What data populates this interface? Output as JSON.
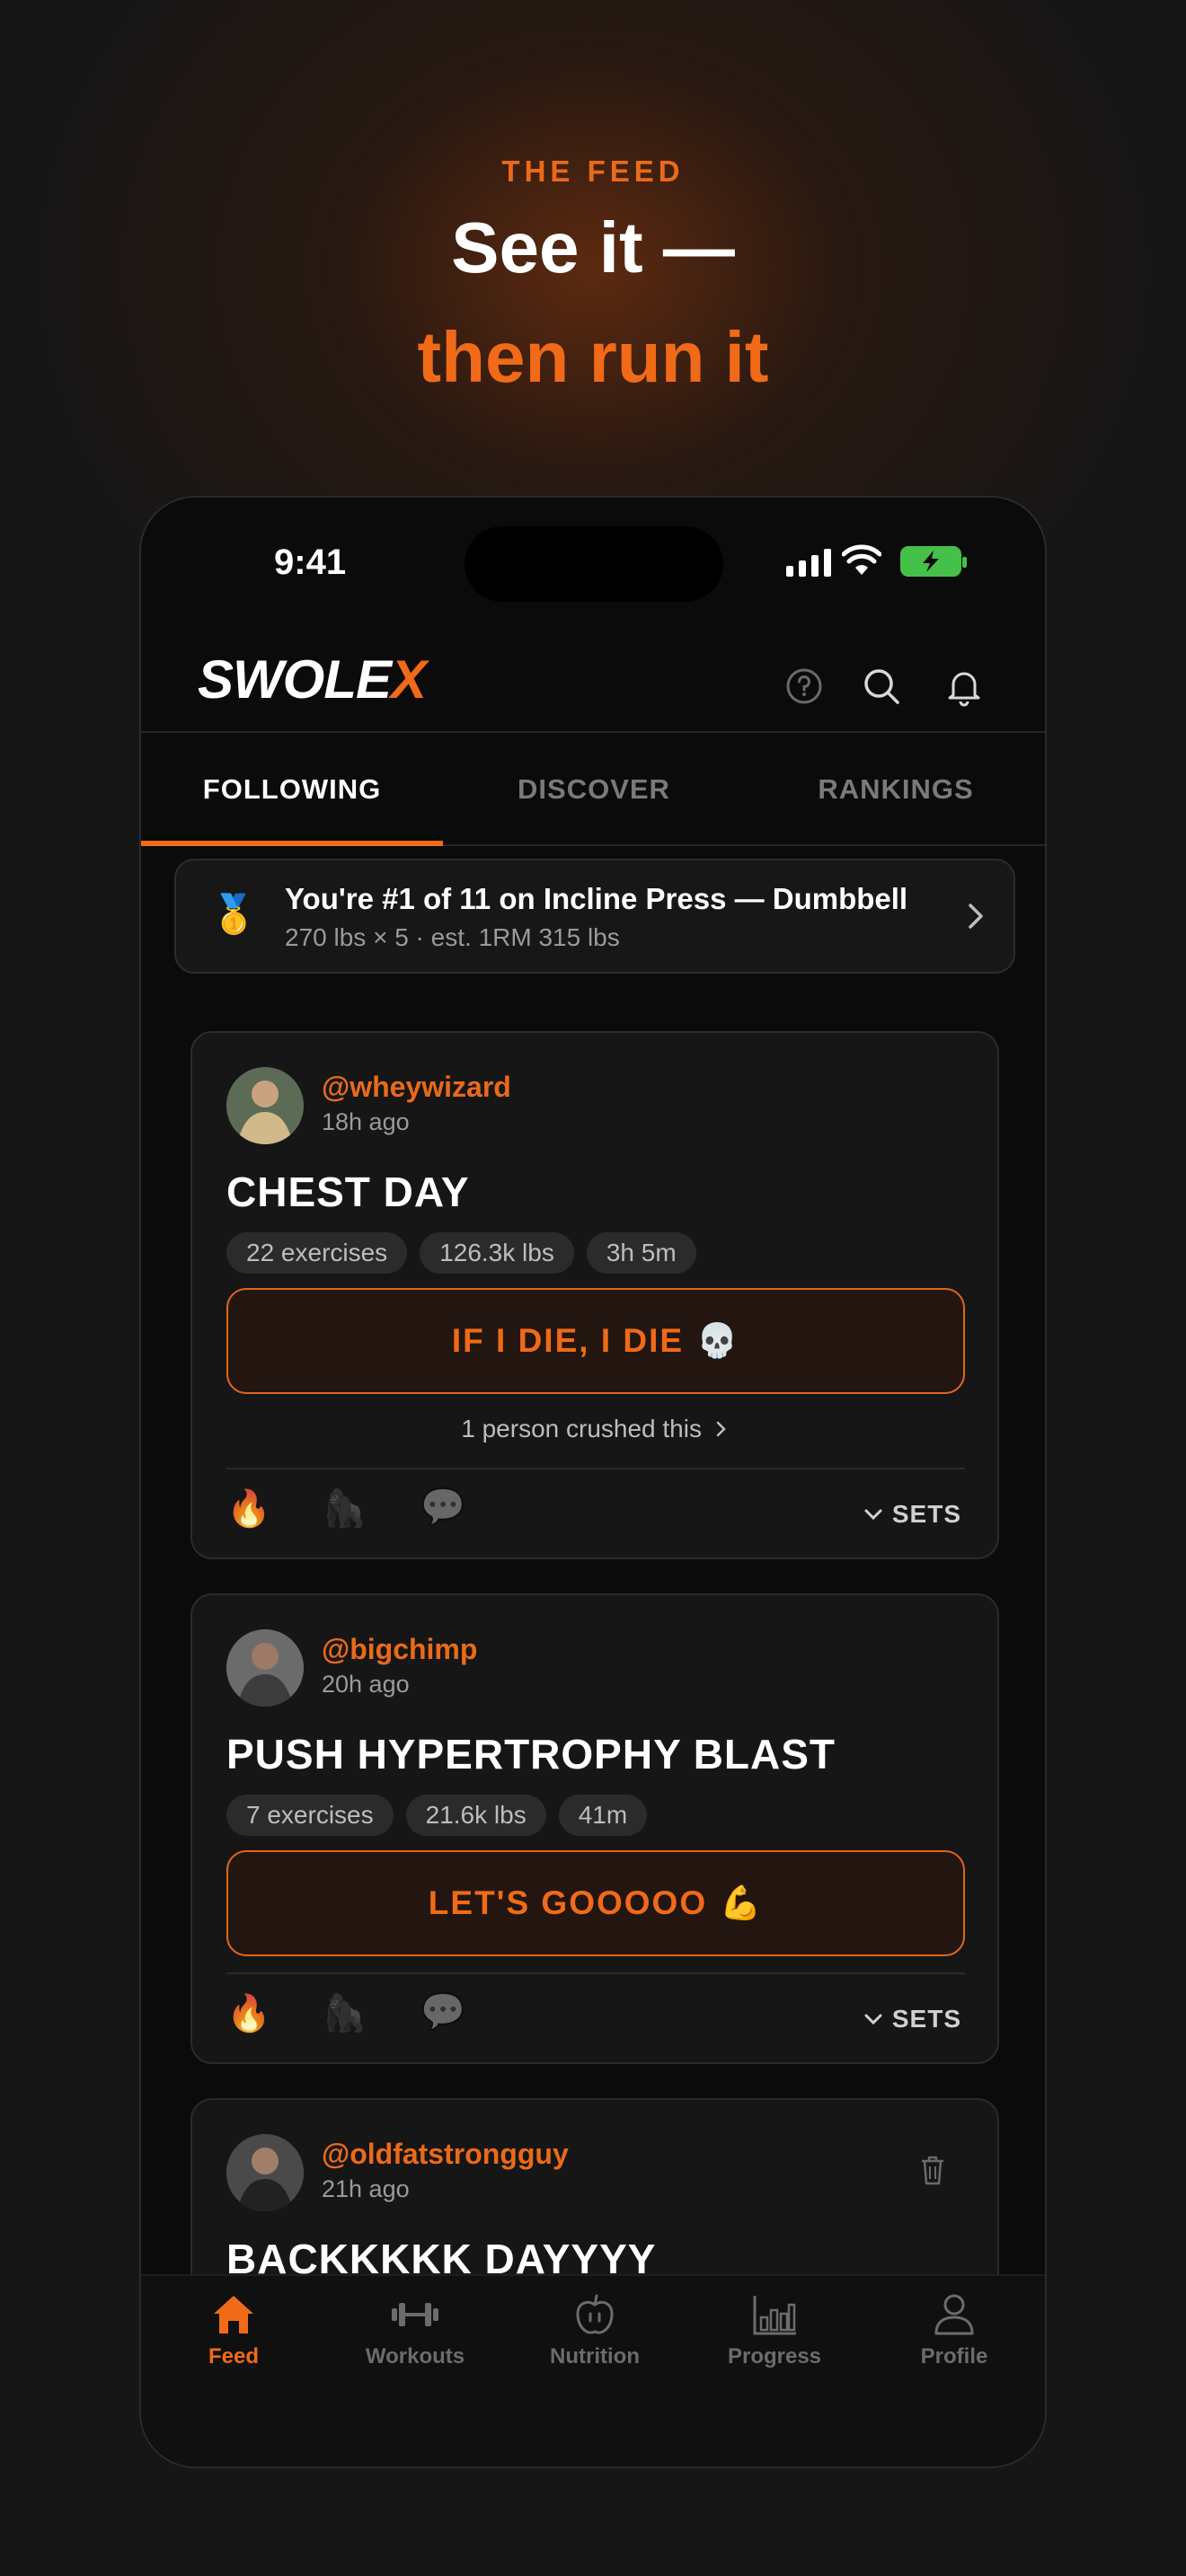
{
  "hero": {
    "eyebrow": "THE FEED",
    "title_line1": "See it —",
    "title_line2": "then run it"
  },
  "status_bar": {
    "time": "9:41"
  },
  "app": {
    "logo_main": "SWOLE",
    "logo_accent": "X"
  },
  "tabs": [
    {
      "label": "FOLLOWING",
      "active": true
    },
    {
      "label": "DISCOVER",
      "active": false
    },
    {
      "label": "RANKINGS",
      "active": false
    }
  ],
  "banner": {
    "medal": "🥇",
    "title": "You're #1 of 11 on Incline Press — Dumbbell",
    "subtitle": "270 lbs × 5 · est. 1RM 315 lbs"
  },
  "posts": [
    {
      "username": "@wheywizard",
      "time_ago": "18h ago",
      "title": "CHEST DAY",
      "chips": [
        "22 exercises",
        "126.3k lbs",
        "3h 5m"
      ],
      "cta_label": "IF I DIE, I DIE",
      "cta_emoji": "💀",
      "crushed": "1 person crushed this",
      "reactions": [
        "🔥",
        "🦍",
        "💬"
      ],
      "sets_label": "SETS"
    },
    {
      "username": "@bigchimp",
      "time_ago": "20h ago",
      "title": "PUSH HYPERTROPHY BLAST",
      "chips": [
        "7 exercises",
        "21.6k lbs",
        "41m"
      ],
      "cta_label": "LET'S GOOOOO",
      "cta_emoji": "💪",
      "reactions": [
        "🔥",
        "🦍",
        "💬"
      ],
      "sets_label": "SETS"
    },
    {
      "username": "@oldfatstrongguy",
      "time_ago": "21h ago",
      "title": "BACKKKKK DAYYYY"
    }
  ],
  "bottom_nav": [
    {
      "label": "Feed",
      "icon": "home-icon",
      "active": true
    },
    {
      "label": "Workouts",
      "icon": "dumbbell-icon",
      "active": false
    },
    {
      "label": "Nutrition",
      "icon": "apple-icon",
      "active": false
    },
    {
      "label": "Progress",
      "icon": "bar-chart-icon",
      "active": false
    },
    {
      "label": "Profile",
      "icon": "person-icon",
      "active": false
    }
  ],
  "colors": {
    "accent": "#f06a18",
    "background": "#171616",
    "card": "#161616"
  }
}
